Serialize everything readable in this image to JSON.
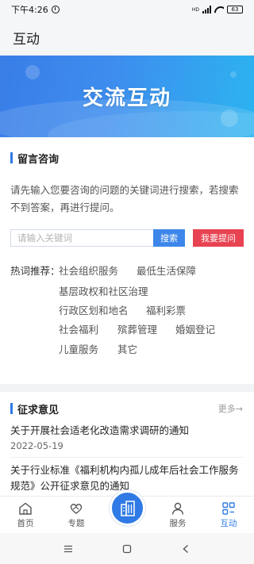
{
  "status_bar": {
    "time": "下午4:26",
    "network": "HD",
    "battery": "63"
  },
  "header": {
    "title": "互动"
  },
  "banner": {
    "title": "交流互动"
  },
  "consult": {
    "title": "留言咨询",
    "intro": "请先输入您要咨询的问题的关键词进行搜索，若搜索不到答案，再进行提问。",
    "search_placeholder": "请输入关键词",
    "search_value": "",
    "search_label": "搜索",
    "ask_label": "我要提问",
    "hot_label": "热词推荐：",
    "keywords": [
      "社会组织服务",
      "最低生活保障",
      "基层政权和社区治理",
      "行政区划和地名",
      "福利彩票",
      "社会福利",
      "殡葬管理",
      "婚姻登记",
      "儿童服务",
      "其它"
    ]
  },
  "opinions": {
    "title": "征求意见",
    "more_label": "更多→",
    "items": [
      {
        "title": "关于开展社会适老化改造需求调研的通知",
        "date": "2022-05-19"
      },
      {
        "title": "关于行业标准《福利机构内孤儿成年后社会工作服务规范》公开征求意见的通知"
      }
    ]
  },
  "bottom_nav": {
    "items": [
      {
        "label": "首页",
        "icon": "home-icon"
      },
      {
        "label": "专题",
        "icon": "heart-hands-icon"
      },
      {
        "label": "",
        "icon": "building-icon"
      },
      {
        "label": "服务",
        "icon": "person-icon"
      },
      {
        "label": "互动",
        "icon": "grid-icon"
      }
    ],
    "active_color": "#2f7ae5"
  },
  "colors": {
    "accent": "#2f7ae5",
    "danger": "#e84352"
  }
}
